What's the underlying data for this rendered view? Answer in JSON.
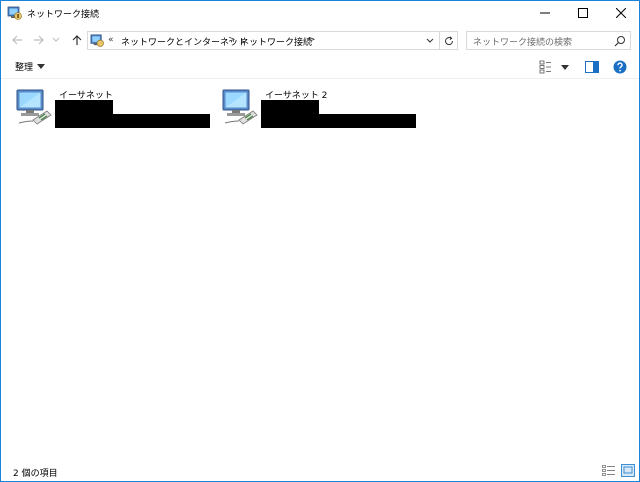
{
  "window": {
    "title": "ネットワーク接続"
  },
  "address": {
    "overflow": "«",
    "crumbs": [
      "ネットワークとインターネット",
      "ネットワーク接続"
    ],
    "separator": ">"
  },
  "search": {
    "placeholder": "ネットワーク接続の検索"
  },
  "toolbar": {
    "organize_label": "整理"
  },
  "connections": [
    {
      "name": "イーサネット",
      "icon": "ethernet-adapter-icon"
    },
    {
      "name": "イーサネット 2",
      "icon": "ethernet-adapter-icon"
    }
  ],
  "status": {
    "item_count": "2 個の項目"
  },
  "colors": {
    "accent": "#1883d7",
    "help_blue": "#1a6fc4"
  }
}
